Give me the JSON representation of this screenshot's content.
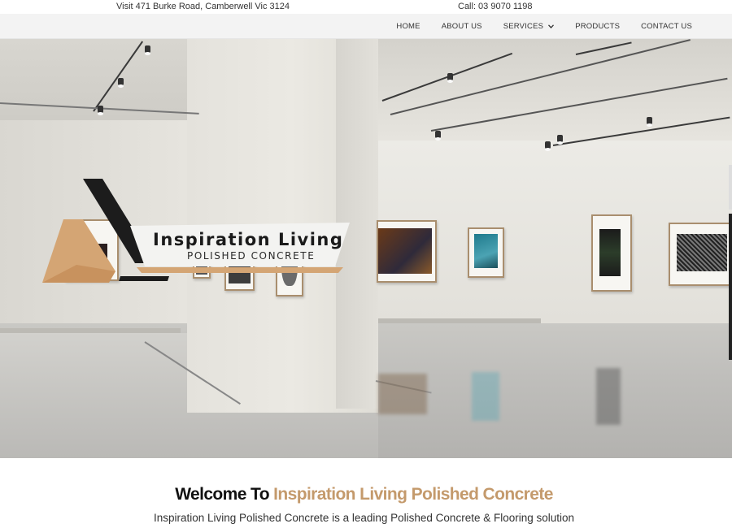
{
  "topbar": {
    "address": "Visit 471 Burke Road, Camberwell Vic 3124",
    "phone": "Call: 03 9070 1198"
  },
  "nav": {
    "items": [
      {
        "label": "HOME"
      },
      {
        "label": "ABOUT US"
      },
      {
        "label": "SERVICES",
        "has_dropdown": true
      },
      {
        "label": "PRODUCTS"
      },
      {
        "label": "CONTACT US"
      }
    ],
    "dropdown_icon": "chevron-down-icon"
  },
  "logo": {
    "title": "Inspiration Living",
    "subtitle": "POLISHED CONCRETE",
    "colors": {
      "black": "#1a1a1a",
      "tan": "#d4a574",
      "banner": "#f4f4f2"
    }
  },
  "hero": {
    "image": "art gallery interior with polished concrete floor"
  },
  "welcome": {
    "heading_prefix": "Welcome To ",
    "heading_accent": "Inspiration Living Polished Concrete",
    "intro": "Inspiration Living Polished Concrete is a leading Polished Concrete & Flooring solution",
    "accent_color": "#c49a6c"
  }
}
